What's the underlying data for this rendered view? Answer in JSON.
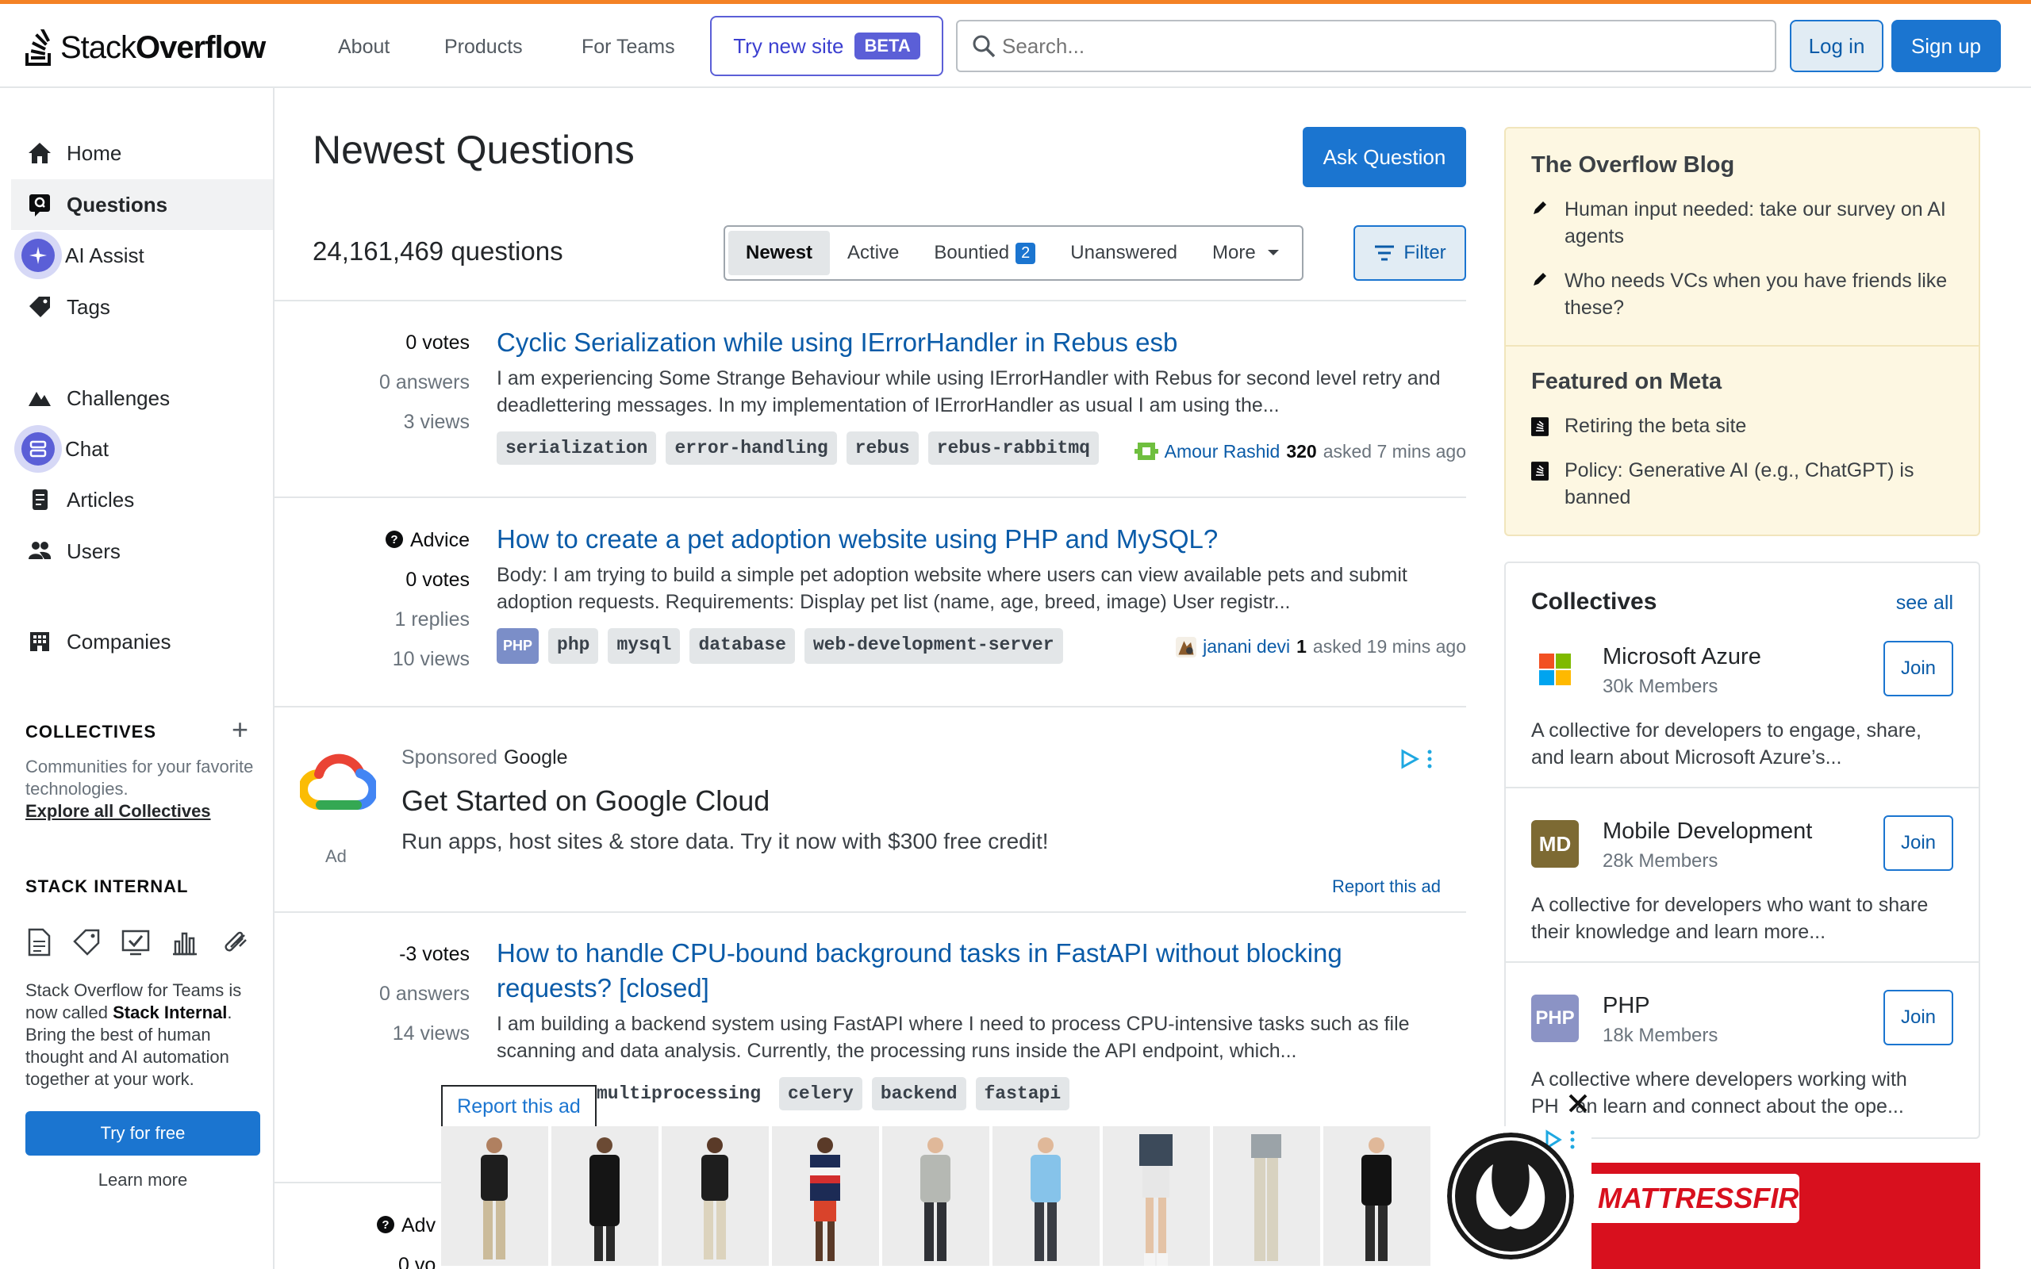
{
  "header": {
    "logo_text_1": "Stack",
    "logo_text_2": "Overflow",
    "nav": [
      "About",
      "Products",
      "For Teams"
    ],
    "try_new_label": "Try new site",
    "beta_label": "BETA",
    "search_placeholder": "Search...",
    "login_label": "Log in",
    "signup_label": "Sign up"
  },
  "leftnav": {
    "items": [
      {
        "label": "Home",
        "icon": "home-icon"
      },
      {
        "label": "Questions",
        "icon": "questions-icon"
      },
      {
        "label": "AI Assist",
        "icon": "ai-assist-icon"
      },
      {
        "label": "Tags",
        "icon": "tag-icon"
      },
      {
        "label": "Challenges",
        "icon": "challenges-icon"
      },
      {
        "label": "Chat",
        "icon": "chat-icon"
      },
      {
        "label": "Articles",
        "icon": "articles-icon"
      },
      {
        "label": "Users",
        "icon": "users-icon"
      },
      {
        "label": "Companies",
        "icon": "companies-icon"
      }
    ],
    "collectives_title": "COLLECTIVES",
    "collectives_desc": "Communities for your favorite technologies.",
    "collectives_link": "Explore all Collectives",
    "internal_title": "STACK INTERNAL",
    "internal_desc_1": "Stack Overflow for Teams is now called ",
    "internal_desc_bold": "Stack Internal",
    "internal_desc_2": ". Bring the best of human thought and AI automation together at your work.",
    "try_free_label": "Try for free",
    "learn_more_label": "Learn more"
  },
  "main": {
    "title": "Newest Questions",
    "ask_label": "Ask Question",
    "count_text": "24,161,469 questions",
    "tabs": [
      {
        "label": "Newest"
      },
      {
        "label": "Active"
      },
      {
        "label": "Bountied",
        "badge": "2"
      },
      {
        "label": "Unanswered"
      },
      {
        "label": "More"
      }
    ],
    "filter_label": "Filter",
    "questions": [
      {
        "votes": "0 votes",
        "answers": "0 answers",
        "views": "3 views",
        "title": "Cyclic Serialization while using IErrorHandler in Rebus esb",
        "excerpt": "I am experiencing Some Strange Behaviour while using IErrorHandler with Rebus for second level retry and deadlettering messages. In my implementation of IErrorHandler as usual I am using the...",
        "tags": [
          "serialization",
          "error-handling",
          "rebus",
          "rebus-rabbitmq"
        ],
        "user": "Amour Rashid",
        "rep": "320",
        "asked": "asked 7 mins ago"
      },
      {
        "advice": "Advice",
        "votes": "0 votes",
        "answers": "1 replies",
        "views": "10 views",
        "title": "How to create a pet adoption website using PHP and MySQL?",
        "excerpt": "Body: I am trying to build a simple pet adoption website where users can view available pets and submit adoption requests. Requirements: Display pet list (name, age, breed, image) User registr...",
        "tag_icon": "PHP",
        "tags": [
          "php",
          "mysql",
          "database",
          "web-development-server"
        ],
        "user": "janani devi",
        "rep": "1",
        "asked": "asked 19 mins ago"
      },
      {
        "votes": "-3 votes",
        "answers": "0 answers",
        "views": "14 views",
        "title_1": "How to handle CPU-bound background tasks in FastAPI without blocking",
        "title_2": "requests? [closed]",
        "excerpt": "I am building a backend system using FastAPI where I need to process CPU-intensive tasks such as file scanning and data analysis. Currently, the processing runs inside the API endpoint, which...",
        "tags": [
          "multiprocessing",
          "celery",
          "backend",
          "fastapi"
        ]
      }
    ],
    "partial_advice": "Adv",
    "partial_votes": "0 vo"
  },
  "ad": {
    "sponsored": "Sponsored",
    "advertiser": "Google",
    "title": "Get Started on Google Cloud",
    "text": "Run apps, host sites & store data. Try it now with $300 free credit!",
    "label": "Ad",
    "report": "Report this ad"
  },
  "blog": {
    "heading": "The Overflow Blog",
    "items": [
      "Human input needed: take our survey on AI agents",
      "Who needs VCs when you have friends like these?"
    ],
    "meta_heading": "Featured on Meta",
    "meta_items": [
      "Retiring the beta site",
      "Policy: Generative AI (e.g., ChatGPT) is banned"
    ]
  },
  "collectives": {
    "heading": "Collectives",
    "see_all": "see all",
    "items": [
      {
        "name": "Microsoft Azure",
        "members": "30k Members",
        "join": "Join",
        "desc": "A collective for developers to engage, share, and learn about Microsoft Azure’s..."
      },
      {
        "name": "Mobile Development",
        "members": "28k Members",
        "join": "Join",
        "icon_text": "MD",
        "desc": "A collective for developers who want to share their knowledge and learn more..."
      },
      {
        "name": "PHP",
        "members": "18k Members",
        "join": "Join",
        "icon_text": "PHP",
        "desc_1": "A collective where developers working with",
        "desc_2a": "PH",
        "desc_2b": "an learn and connect about the ope..."
      }
    ]
  },
  "bottom_ad": {
    "report": "Report this ad",
    "brand2": "MATTRESSFIRM"
  },
  "colors": {
    "accent": "#f48225",
    "link": "#0a5ba8",
    "primary": "#1b75d0",
    "beta": "#5b5fd7"
  }
}
